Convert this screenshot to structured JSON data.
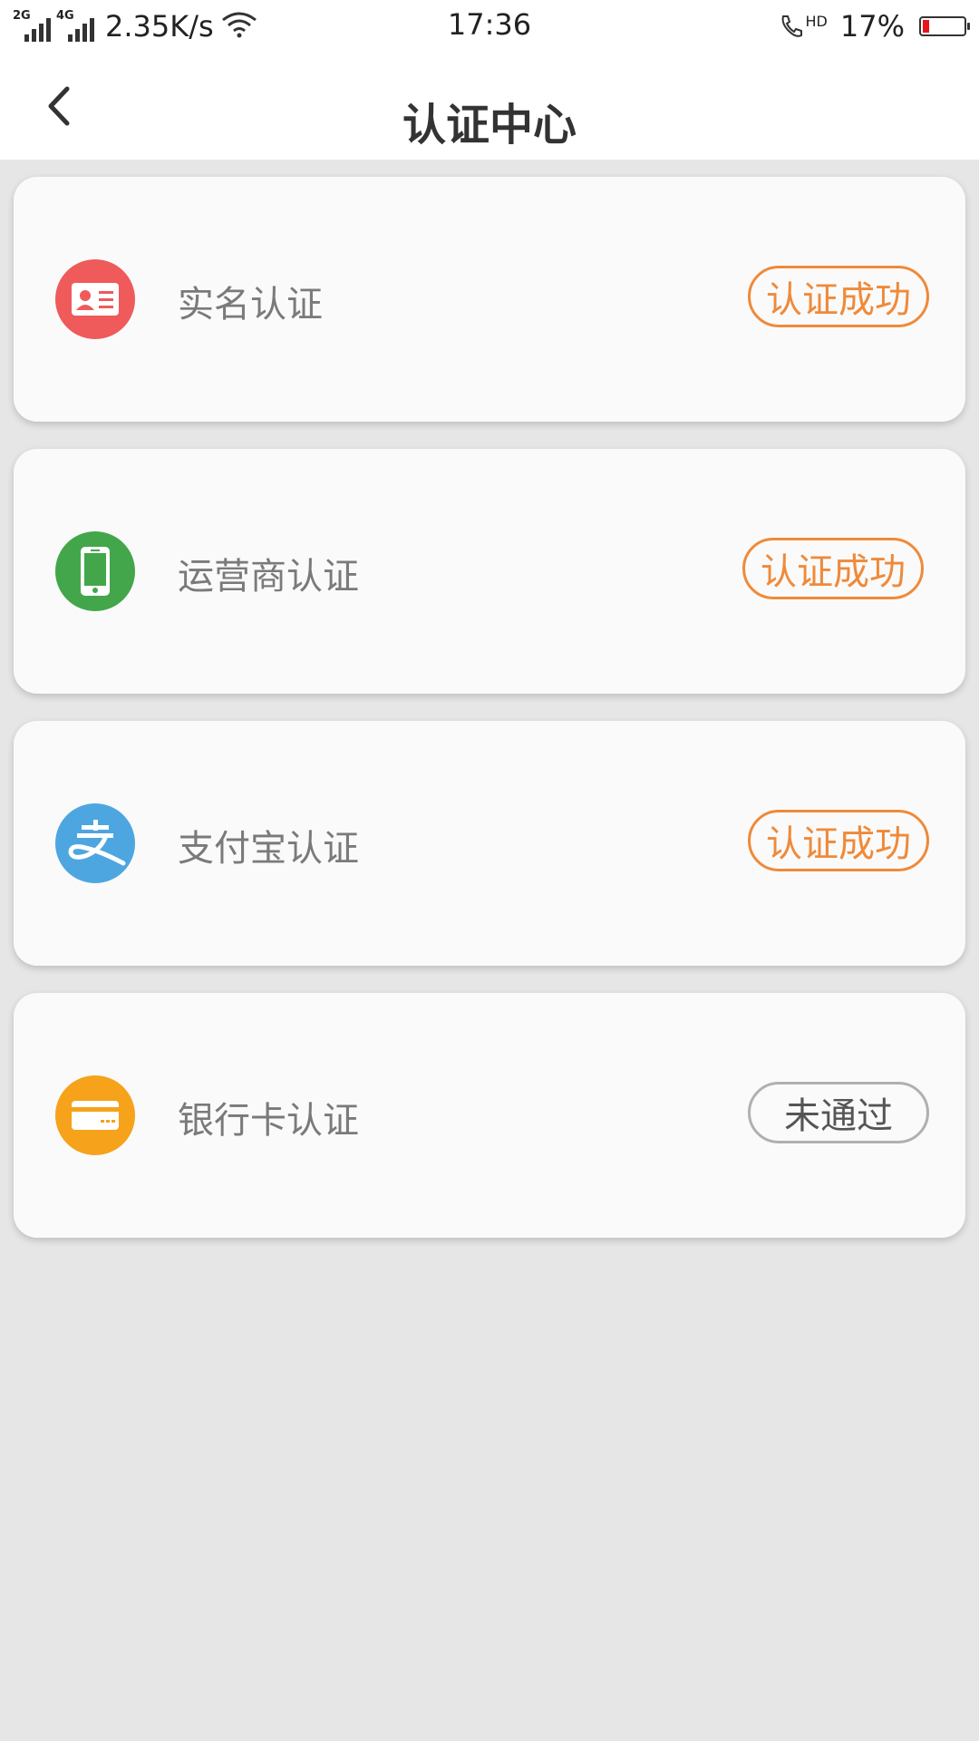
{
  "status_bar": {
    "signal1_label": "2G",
    "signal2_label": "4G",
    "network_speed": "2.35K/s",
    "time": "17:36",
    "call_label": "HD",
    "battery_percent": "17%",
    "battery_level": 0.17
  },
  "nav": {
    "back_icon": "chevron-left-icon",
    "title": "认证中心"
  },
  "cards": [
    {
      "label": "实名认证",
      "status": "认证成功",
      "icon": "id-card-icon",
      "icon_color": "#ef5a5a"
    },
    {
      "label": "运营商认证",
      "status": "认证成功",
      "icon": "mobile-phone-icon",
      "icon_color": "#43a64a"
    },
    {
      "label": "支付宝认证",
      "status": "认证成功",
      "icon": "alipay-icon",
      "icon_color": "#4ea6e0"
    },
    {
      "label": "银行卡认证",
      "status": "未通过",
      "icon": "bank-card-icon",
      "icon_color": "#f6a21b"
    }
  ],
  "colors": {
    "success": "#ef8a3a",
    "fail_border": "#b0b0b0",
    "background": "#e6e6e6"
  }
}
